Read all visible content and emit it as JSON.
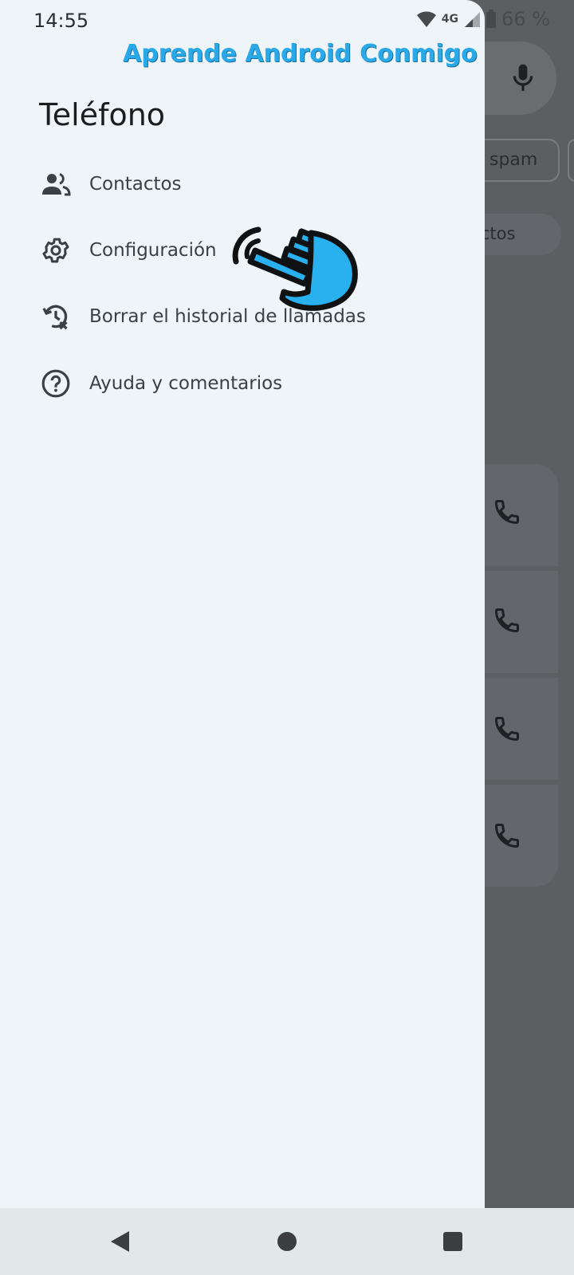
{
  "status_bar": {
    "time": "14:55",
    "network": "4G",
    "battery": "66 %"
  },
  "watermark": "Aprende Android Conmigo",
  "drawer": {
    "title": "Teléfono",
    "items": [
      {
        "label": "Contactos",
        "icon": "contacts-icon"
      },
      {
        "label": "Configuración",
        "icon": "settings-gear-icon"
      },
      {
        "label": "Borrar el historial de llamadas",
        "icon": "clear-call-history-icon"
      },
      {
        "label": "Ayuda y comentarios",
        "icon": "help-icon"
      }
    ]
  },
  "background": {
    "chip_label": "spam",
    "tab_label": "actos"
  },
  "colors": {
    "accent_watermark": "#2aa9e8",
    "hand": "#29b0ee",
    "drawer_bg": "#eef4f8",
    "scrim": "#5c5f61"
  }
}
